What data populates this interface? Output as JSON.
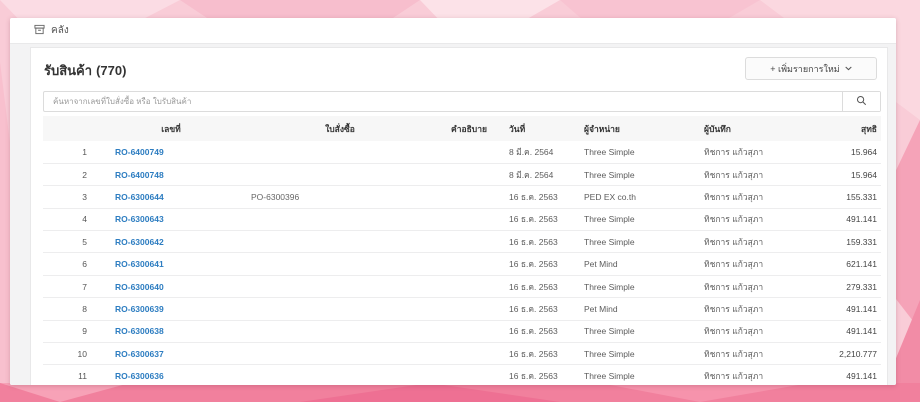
{
  "topbar": {
    "breadcrumb": "คลัง"
  },
  "header": {
    "title": "รับสินค้า",
    "count": "(770)",
    "add_button_label": "+ เพิ่มรายการใหม่"
  },
  "search": {
    "placeholder": "ค้นหาจากเลขที่ใบสั่งซื้อ หรือ ใบรับสินค้า"
  },
  "icons": {
    "breadcrumb_icon": "archive-box-icon",
    "search_icon": "magnifier-icon",
    "add_button_icon": "chevron-down-icon"
  },
  "colors": {
    "link_blue": "#2d7dc1",
    "header_bg": "#f7f7f7",
    "page_pink": "#f9ccd7",
    "bottom_band_pink": "#f1809d"
  },
  "table": {
    "headers": [
      "เลขที่",
      "ใบสั่งซื้อ",
      "คำอธิบาย",
      "วันที่",
      "ผู้จำหน่าย",
      "ผู้บันทึก",
      "สุทธิ"
    ],
    "rows": [
      {
        "index": "1",
        "number": "RO-6400749",
        "po": "",
        "description": "",
        "date": "8 มี.ค. 2564",
        "vendor": "Three Simple",
        "recorder": "ทิชการ แก้วสุภา",
        "total": "15.964"
      },
      {
        "index": "2",
        "number": "RO-6400748",
        "po": "",
        "description": "",
        "date": "8 มี.ค. 2564",
        "vendor": "Three Simple",
        "recorder": "ทิชการ แก้วสุภา",
        "total": "15.964"
      },
      {
        "index": "3",
        "number": "RO-6300644",
        "po": "PO-6300396",
        "description": "",
        "date": "16 ธ.ค. 2563",
        "vendor": "PED EX co.th",
        "recorder": "ทิชการ แก้วสุภา",
        "total": "155.331"
      },
      {
        "index": "4",
        "number": "RO-6300643",
        "po": "",
        "description": "",
        "date": "16 ธ.ค. 2563",
        "vendor": "Three Simple",
        "recorder": "ทิชการ แก้วสุภา",
        "total": "491.141"
      },
      {
        "index": "5",
        "number": "RO-6300642",
        "po": "",
        "description": "",
        "date": "16 ธ.ค. 2563",
        "vendor": "Three Simple",
        "recorder": "ทิชการ แก้วสุภา",
        "total": "159.331"
      },
      {
        "index": "6",
        "number": "RO-6300641",
        "po": "",
        "description": "",
        "date": "16 ธ.ค. 2563",
        "vendor": "Pet Mind",
        "recorder": "ทิชการ แก้วสุภา",
        "total": "621.141"
      },
      {
        "index": "7",
        "number": "RO-6300640",
        "po": "",
        "description": "",
        "date": "16 ธ.ค. 2563",
        "vendor": "Three Simple",
        "recorder": "ทิชการ แก้วสุภา",
        "total": "279.331"
      },
      {
        "index": "8",
        "number": "RO-6300639",
        "po": "",
        "description": "",
        "date": "16 ธ.ค. 2563",
        "vendor": "Pet Mind",
        "recorder": "ทิชการ แก้วสุภา",
        "total": "491.141"
      },
      {
        "index": "9",
        "number": "RO-6300638",
        "po": "",
        "description": "",
        "date": "16 ธ.ค. 2563",
        "vendor": "Three Simple",
        "recorder": "ทิชการ แก้วสุภา",
        "total": "491.141"
      },
      {
        "index": "10",
        "number": "RO-6300637",
        "po": "",
        "description": "",
        "date": "16 ธ.ค. 2563",
        "vendor": "Three Simple",
        "recorder": "ทิชการ แก้วสุภา",
        "total": "2,210.777"
      },
      {
        "index": "11",
        "number": "RO-6300636",
        "po": "",
        "description": "",
        "date": "16 ธ.ค. 2563",
        "vendor": "Three Simple",
        "recorder": "ทิชการ แก้วสุภา",
        "total": "491.141"
      }
    ]
  }
}
